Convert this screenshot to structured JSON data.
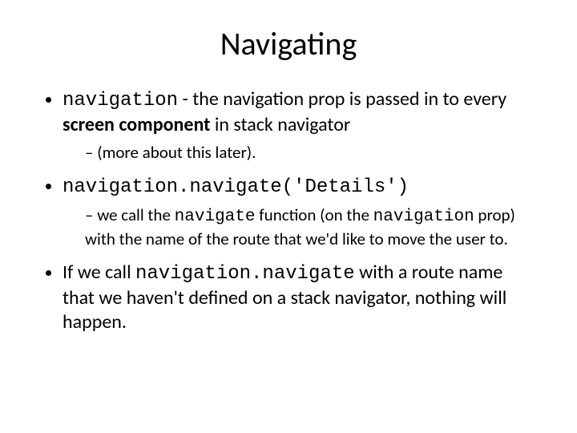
{
  "title": "Navigating",
  "b1": {
    "code": "navigation",
    "t1": " - the navigation prop is passed in to every ",
    "bold": "screen component",
    "t2": " in stack navigator",
    "sub": "(more about this later)."
  },
  "b2": {
    "code": "navigation.navigate('Details')",
    "sub_t1": "we call the ",
    "sub_c1": "navigate",
    "sub_t2": " function (on the ",
    "sub_c2": "navigation",
    "sub_t3": " prop) with the name of the route that we'd like to move the user to."
  },
  "b3": {
    "t1": "If we call ",
    "code": "navigation.navigate",
    "t2": " with a route name that we haven't defined on a stack navigator, nothing will happen."
  }
}
